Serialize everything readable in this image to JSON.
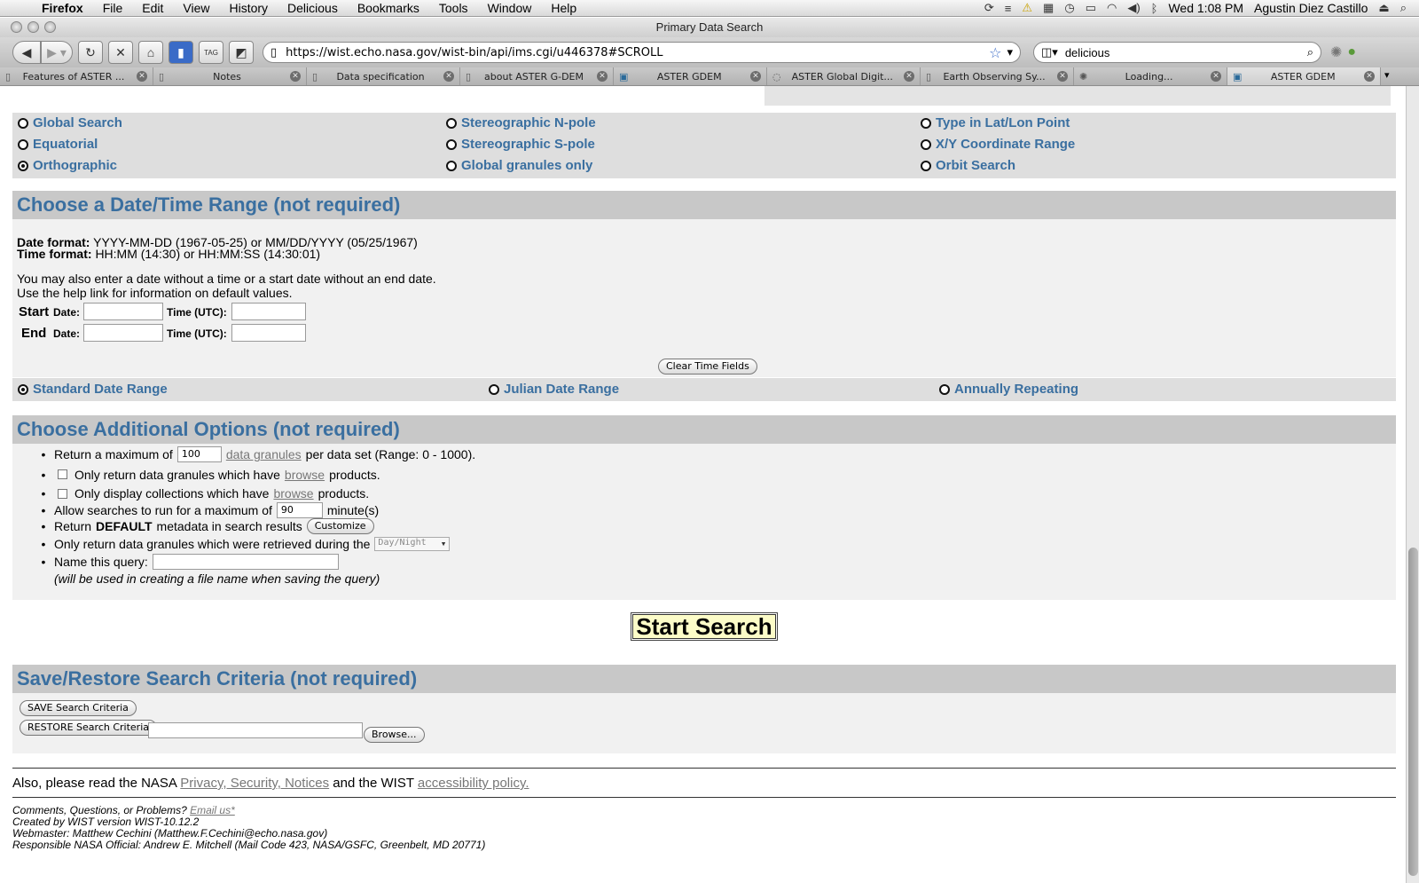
{
  "menubar": {
    "app": "Firefox",
    "items": [
      "File",
      "Edit",
      "View",
      "History",
      "Delicious",
      "Bookmarks",
      "Tools",
      "Window",
      "Help"
    ],
    "clock": "Wed 1:08 PM",
    "user": "Agustin Diez Castillo"
  },
  "window": {
    "title": "Primary Data Search"
  },
  "nav": {
    "url": "https://wist.echo.nasa.gov/wist-bin/api/ims.cgi/u446378#SCROLL",
    "search_value": "delicious"
  },
  "tabs": [
    {
      "label": "Features of ASTER ..."
    },
    {
      "label": "Notes"
    },
    {
      "label": "Data specification"
    },
    {
      "label": "about ASTER G-DEM"
    },
    {
      "label": "ASTER GDEM"
    },
    {
      "label": "ASTER Global Digit..."
    },
    {
      "label": "Earth Observing Sy..."
    },
    {
      "label": "Loading..."
    },
    {
      "label": "ASTER GDEM"
    }
  ],
  "projection": {
    "options": [
      {
        "label": "Global Search",
        "selected": false
      },
      {
        "label": "Equatorial",
        "selected": false
      },
      {
        "label": "Orthographic",
        "selected": true
      },
      {
        "label": "Stereographic N-pole",
        "selected": false
      },
      {
        "label": "Stereographic S-pole",
        "selected": false
      },
      {
        "label": "Global granules only",
        "selected": false
      },
      {
        "label": "Type in Lat/Lon Point",
        "selected": false
      },
      {
        "label": "X/Y Coordinate Range",
        "selected": false
      },
      {
        "label": "Orbit Search",
        "selected": false
      }
    ]
  },
  "date_section": {
    "heading": "Choose a Date/Time Range (not required)",
    "date_format_label": "Date format:",
    "date_format": "YYYY-MM-DD (1967-05-25) or MM/DD/YYYY (05/25/1967)",
    "time_format_label": "Time format:",
    "time_format": "HH:MM (14:30) or HH:MM:SS (14:30:01)",
    "note_line1": "You may also enter a date without a time or a start date without an end date.",
    "note_line2": "Use the help link for information on default values.",
    "start_label": "Start",
    "end_label": "End",
    "date_label": "Date:",
    "time_label": "Time (UTC):",
    "clear_button": "Clear Time Fields",
    "range_options": [
      {
        "label": "Standard Date Range",
        "selected": true
      },
      {
        "label": "Julian Date Range",
        "selected": false
      },
      {
        "label": "Annually Repeating",
        "selected": false
      }
    ]
  },
  "options_section": {
    "heading": "Choose Additional Options (not required)",
    "max_prefix": "Return a maximum of",
    "max_value": "100",
    "max_link": "data granules",
    "max_suffix": "per data set (Range: 0 - 1000).",
    "browse1_prefix": "Only return data granules which have",
    "browse_link": "browse",
    "browse1_suffix": "products.",
    "browse2_prefix": "Only display collections which have",
    "browse2_suffix": "products.",
    "time_prefix": "Allow searches to run for a maximum of",
    "time_value": "90",
    "time_suffix": "minute(s)",
    "meta_prefix": "Return",
    "meta_bold": "DEFAULT",
    "meta_suffix": "metadata in search results",
    "customize_button": "Customize",
    "daynight_prefix": "Only return data granules which were retrieved during the",
    "daynight_value": "Day/Night",
    "name_prefix": "Name this query:",
    "name_note": "(will be used in creating a file name when saving the query)"
  },
  "start_search": "Start Search",
  "save_section": {
    "heading": "Save/Restore Search Criteria (not required)",
    "save_button": "SAVE Search Criteria",
    "restore_button": "RESTORE Search Criteria",
    "browse_button": "Browse..."
  },
  "footer": {
    "read_prefix": "Also, please read the NASA",
    "privacy_link": "Privacy, Security, Notices",
    "read_middle": "and the WIST",
    "access_link": "accessibility policy.",
    "comments_prefix": "Comments, Questions, or Problems?",
    "email_link": "Email us*",
    "created": "Created by WIST version WIST-10.12.2",
    "webmaster": "Webmaster: Matthew Cechini (Matthew.F.Cechini@echo.nasa.gov)",
    "official": "Responsible NASA Official: Andrew E. Mitchell (Mail Code 423, NASA/GSFC, Greenbelt, MD 20771)"
  }
}
